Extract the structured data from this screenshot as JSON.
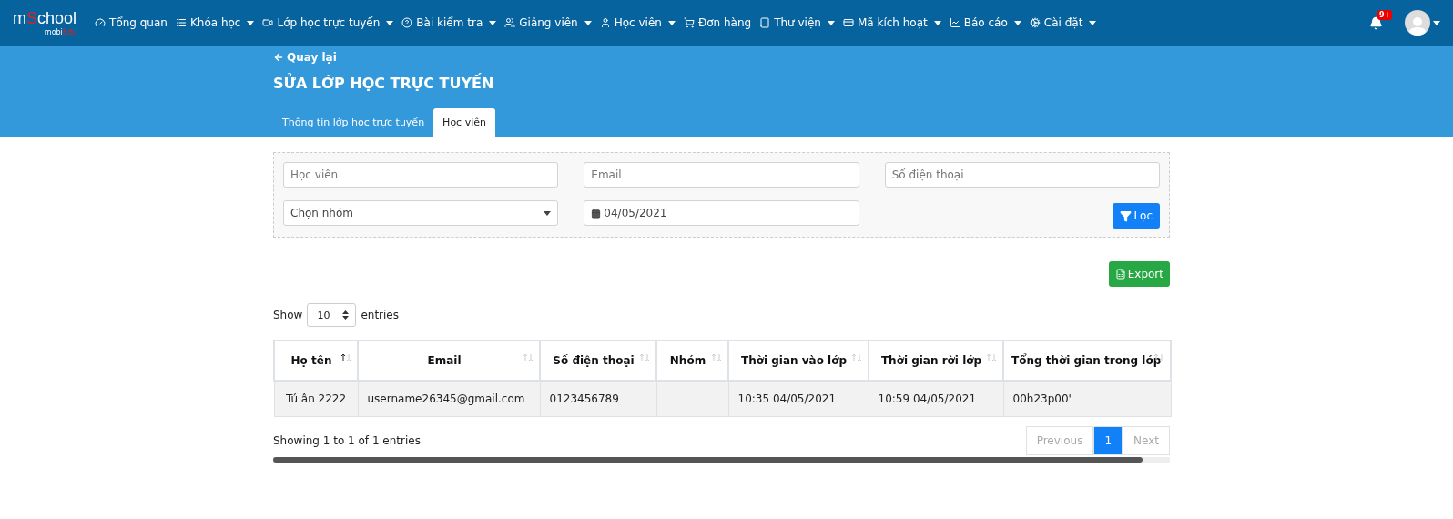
{
  "brand": {
    "name_a": "m",
    "name_b": "S",
    "name_c": "chool",
    "sub_a": "mobi",
    "sub_b": "Edu"
  },
  "nav": [
    {
      "label": "Tổng quan",
      "dropdown": false
    },
    {
      "label": "Khóa học",
      "dropdown": true
    },
    {
      "label": "Lớp học trực tuyến",
      "dropdown": true
    },
    {
      "label": "Bài kiểm tra",
      "dropdown": true
    },
    {
      "label": "Giảng viên",
      "dropdown": true
    },
    {
      "label": "Học viên",
      "dropdown": true
    },
    {
      "label": "Đơn hàng",
      "dropdown": false
    },
    {
      "label": "Thư viện",
      "dropdown": true
    },
    {
      "label": "Mã kích hoạt",
      "dropdown": true
    },
    {
      "label": "Báo cáo",
      "dropdown": true
    },
    {
      "label": "Cài đặt",
      "dropdown": true
    }
  ],
  "notifications": {
    "badge": "9+"
  },
  "header": {
    "back": "Quay lại",
    "title": "SỬA LỚP HỌC TRỰC TUYẾN"
  },
  "tabs": [
    {
      "label": "Thông tin lớp học trực tuyến",
      "selected": false
    },
    {
      "label": "Học viên",
      "selected": true
    }
  ],
  "filters": {
    "fields": [
      {
        "kind": "text",
        "placeholder": "Học viên"
      },
      {
        "kind": "text",
        "placeholder": "Email"
      },
      {
        "kind": "text",
        "placeholder": "Số điện thoại"
      },
      {
        "kind": "select",
        "value": "Chọn nhóm"
      },
      {
        "kind": "date",
        "value": "04/05/2021"
      }
    ],
    "button": "Lọc"
  },
  "export": "Export",
  "length": {
    "show": "Show",
    "value": "10",
    "entries": "entries"
  },
  "table": {
    "columns": [
      {
        "label": "Họ tên",
        "sorted": true
      },
      {
        "label": "Email",
        "sorted": false
      },
      {
        "label": "Số điện thoại",
        "sorted": false
      },
      {
        "label": "Nhóm",
        "sorted": false
      },
      {
        "label": "Thời gian vào lớp",
        "sorted": false
      },
      {
        "label": "Thời gian rời lớp",
        "sorted": false
      },
      {
        "label": "Tổng thời gian trong lớp",
        "sorted": false
      }
    ],
    "rows": [
      [
        "Tú ân 2222",
        "username26345@gmail.com",
        "0123456789",
        "",
        "10:35 04/05/2021",
        "10:59 04/05/2021",
        "00h23p00'"
      ]
    ]
  },
  "info": "Showing 1 to 1 of 1 entries",
  "pagination": [
    {
      "label": "Previous",
      "selected": false,
      "disabled": true
    },
    {
      "label": "1",
      "selected": true,
      "disabled": false
    },
    {
      "label": "Next",
      "selected": false,
      "disabled": true
    }
  ]
}
